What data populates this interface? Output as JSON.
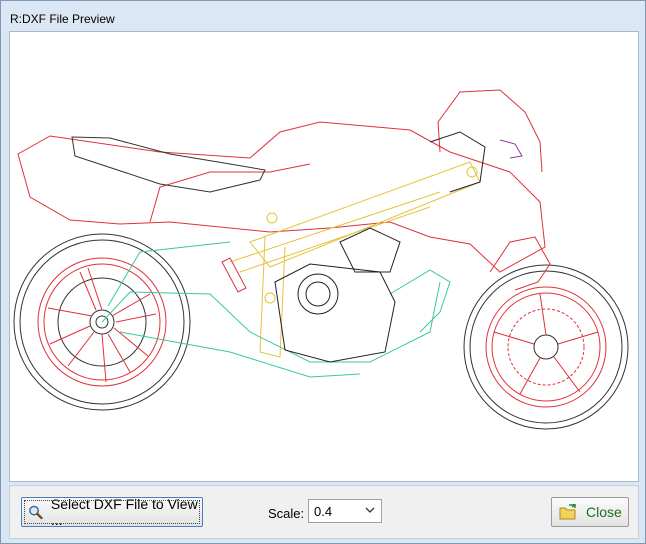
{
  "window": {
    "title": "R:DXF File Preview"
  },
  "toolbar": {
    "select_button_label": "Select DXF File to View ...",
    "select_button_icon": "magnifier-icon",
    "scale_label": "Scale:",
    "scale_value": "0.4",
    "close_button_label": "Close",
    "close_button_icon": "folder-exit-icon"
  },
  "preview": {
    "content": "motorcycle-dxf-drawing",
    "line_colors": {
      "body": "#e0303a",
      "frame": "#e8c23a",
      "subframe": "#38c8a0",
      "engine": "#222222",
      "detail": "#9b2fae"
    }
  }
}
